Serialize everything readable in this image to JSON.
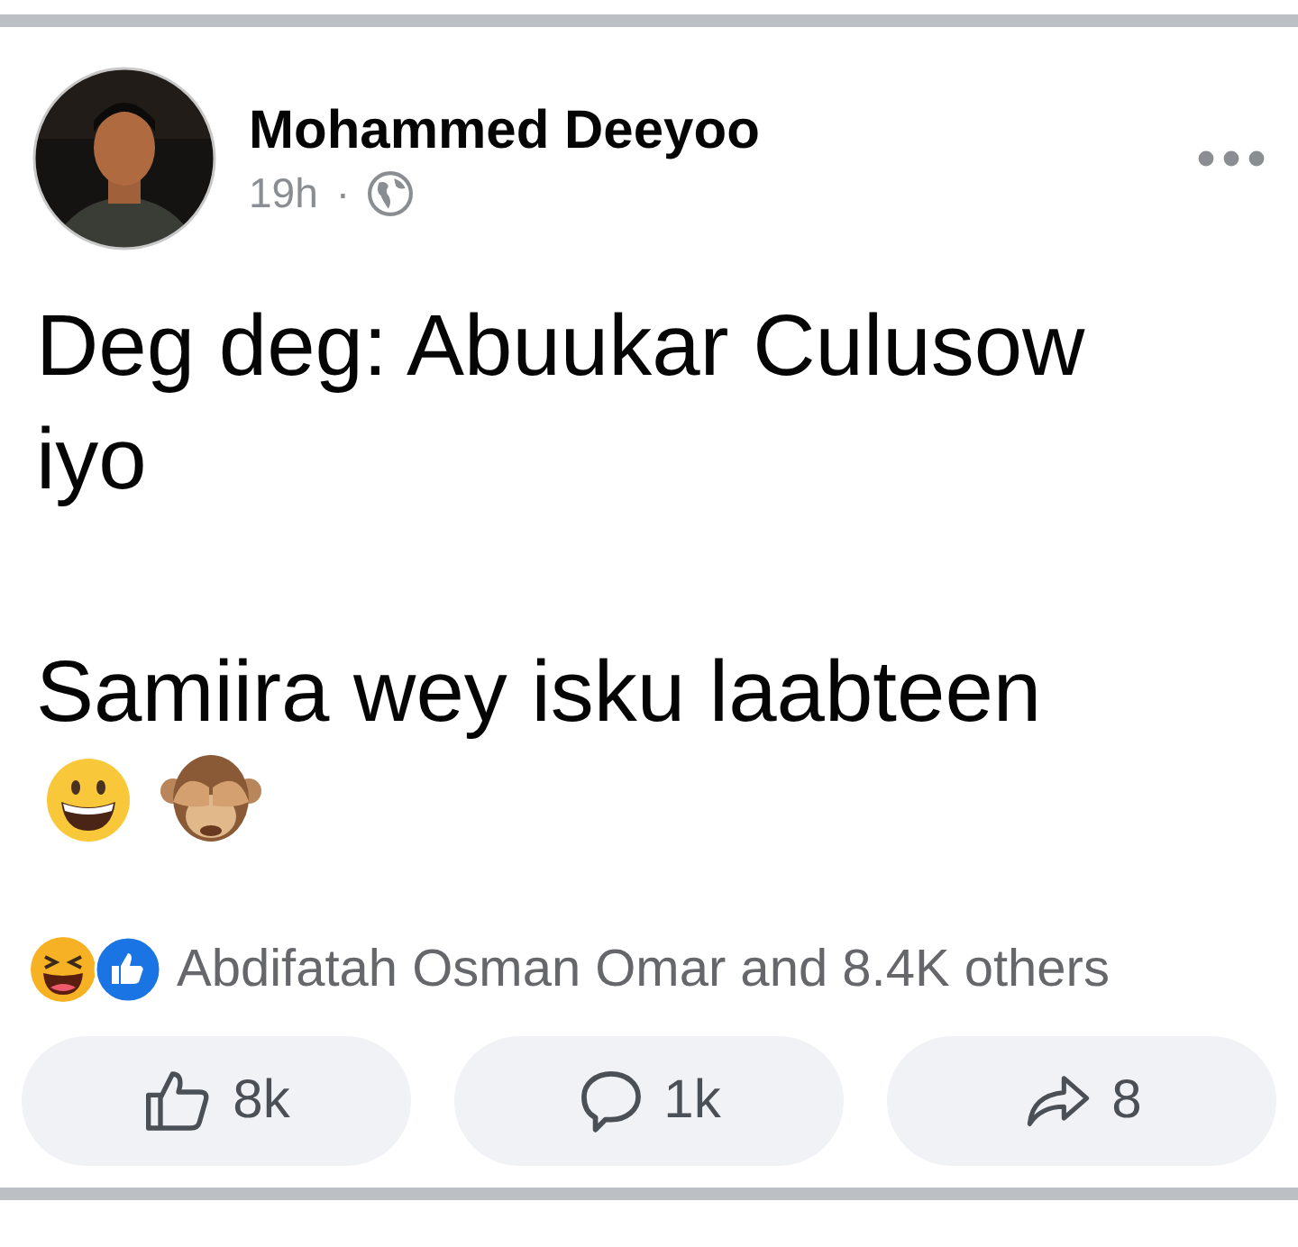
{
  "post": {
    "author": "Mohammed Deeyoo",
    "time": "19h",
    "separator": "·",
    "avatar": {
      "kind": "picture"
    },
    "paragraphs": [
      "Deg deg: Abuukar Culusow iyo",
      "Samiira wey isku laabteen"
    ],
    "reactions_text": "Abdifatah Osman Omar and 8.4K others",
    "actions": [
      {
        "kind": "like",
        "label": "8k"
      },
      {
        "kind": "comment",
        "label": "1k"
      },
      {
        "kind": "share",
        "label": "8"
      }
    ]
  }
}
